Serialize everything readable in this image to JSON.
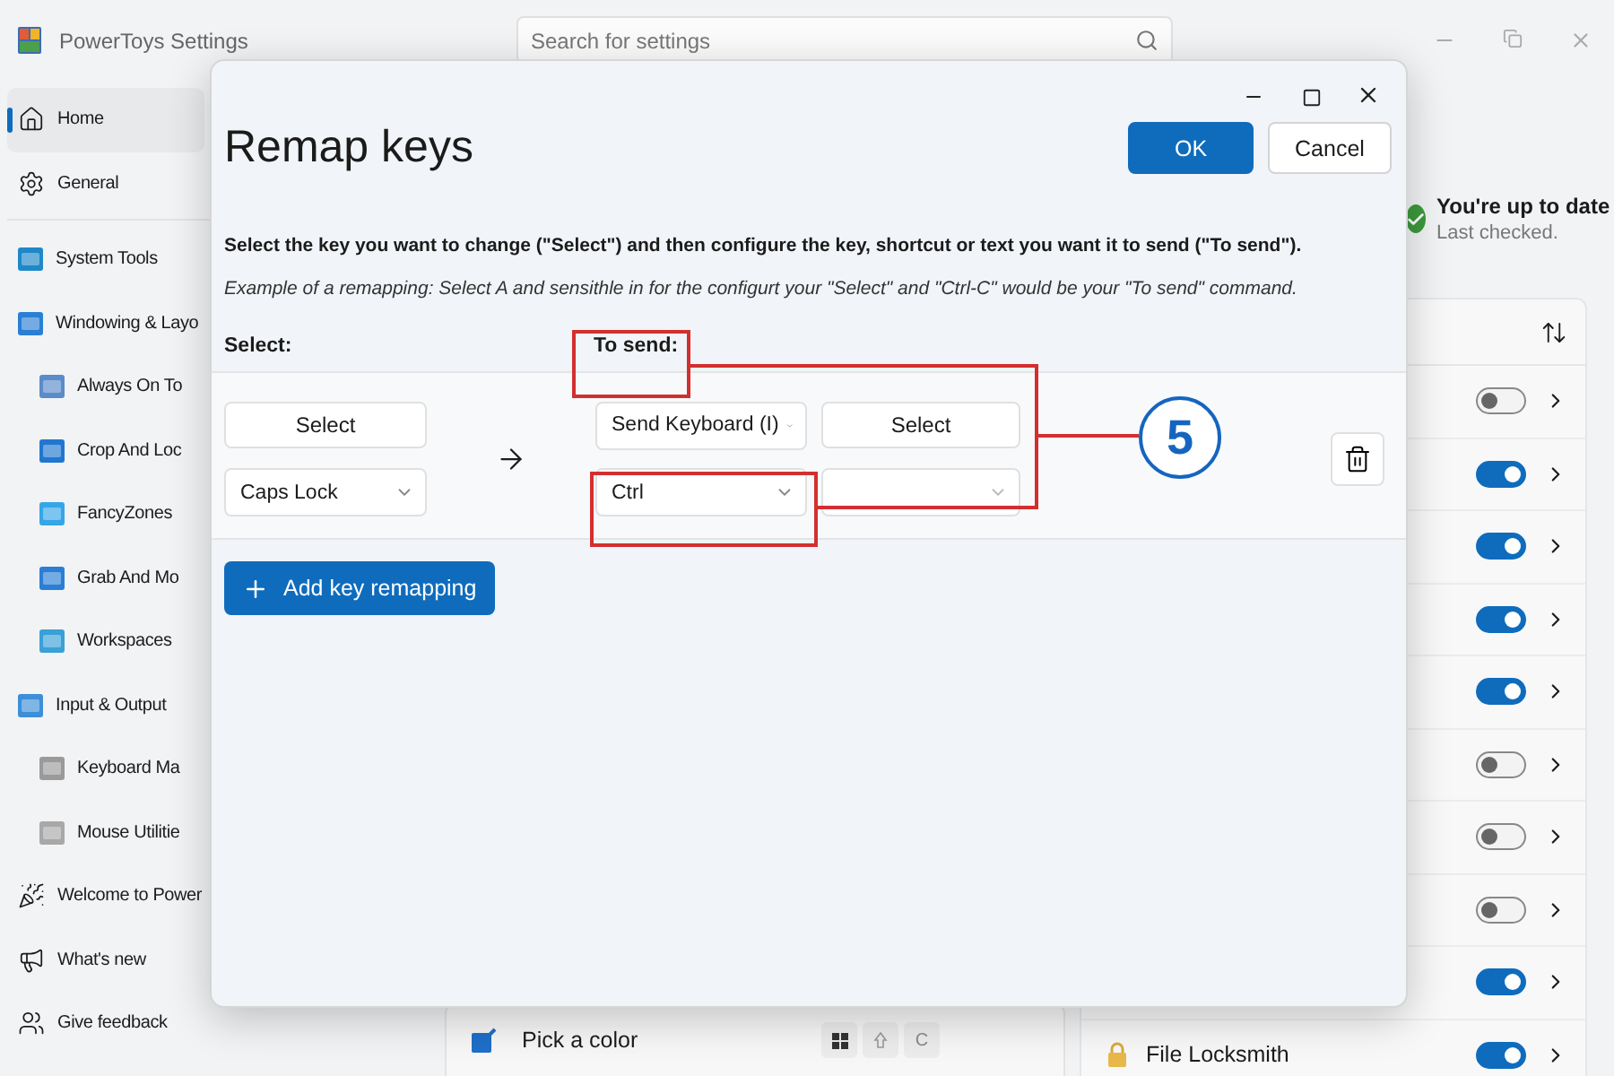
{
  "window": {
    "title": "PowerToys Settings"
  },
  "search": {
    "placeholder": "Search for settings"
  },
  "sidebar": {
    "items": [
      {
        "label": "Home",
        "kind": "home",
        "selected": true
      },
      {
        "label": "General",
        "kind": "gear",
        "selected": false
      },
      {
        "label": "System Tools",
        "kind": "tools",
        "selected": false
      },
      {
        "label": "Windowing & Layo",
        "kind": "grid",
        "selected": false,
        "children": [
          {
            "label": "Always On To",
            "kind": "window",
            "selected": false
          },
          {
            "label": "Crop And Loc",
            "kind": "crop",
            "selected": false
          },
          {
            "label": "FancyZones",
            "kind": "zones",
            "selected": false
          },
          {
            "label": "Grab And Mo",
            "kind": "move",
            "selected": false
          },
          {
            "label": "Workspaces",
            "kind": "workspaces",
            "selected": false
          }
        ]
      },
      {
        "label": "Input & Output",
        "kind": "io",
        "selected": false,
        "children": [
          {
            "label": "Keyboard Ma",
            "kind": "keyboard",
            "selected": false
          },
          {
            "label": "Mouse Utilitie",
            "kind": "mouse",
            "selected": false
          }
        ]
      },
      {
        "label": "Welcome to Power",
        "kind": "welcome",
        "selected": false
      },
      {
        "label": "What's new",
        "kind": "news",
        "selected": false
      },
      {
        "label": "Give feedback",
        "kind": "feedback",
        "selected": false
      }
    ]
  },
  "update_status": {
    "title": "You're up to date",
    "subtitle": "Last checked."
  },
  "modules": [
    {
      "on": false
    },
    {
      "on": true
    },
    {
      "on": true
    },
    {
      "on": true
    },
    {
      "on": true
    },
    {
      "on": false
    },
    {
      "on": false
    },
    {
      "on": false
    },
    {
      "on": true
    },
    {
      "label": "File Locksmith",
      "on": true
    }
  ],
  "shortcut_row": {
    "label": "Pick a color",
    "keys": [
      {
        "kind": "windows"
      },
      {
        "kind": "shift"
      },
      {
        "kind": "text",
        "text": "C"
      }
    ]
  },
  "dialog": {
    "title": "Remap keys",
    "ok": "OK",
    "cancel": "Cancel",
    "instruction": "Select the key you want to change (\"Select\") and then configure the key, shortcut or text you want it to send (\"To send\").",
    "example": "Example of a remapping: Select A and sensithle in for the configurt your \"Select\" and \"Ctrl-C\" would be your \"To send\" command.",
    "select_header": "Select:",
    "send_header": "To send:",
    "remaps": [
      {
        "select_button": "Select",
        "source_key": "Caps Lock",
        "send_type": "Send Keyboard (I)",
        "send_select": "Select",
        "target_key": "Ctrl"
      }
    ],
    "add_button": "Add key remapping"
  },
  "annotation": {
    "number": "5"
  }
}
